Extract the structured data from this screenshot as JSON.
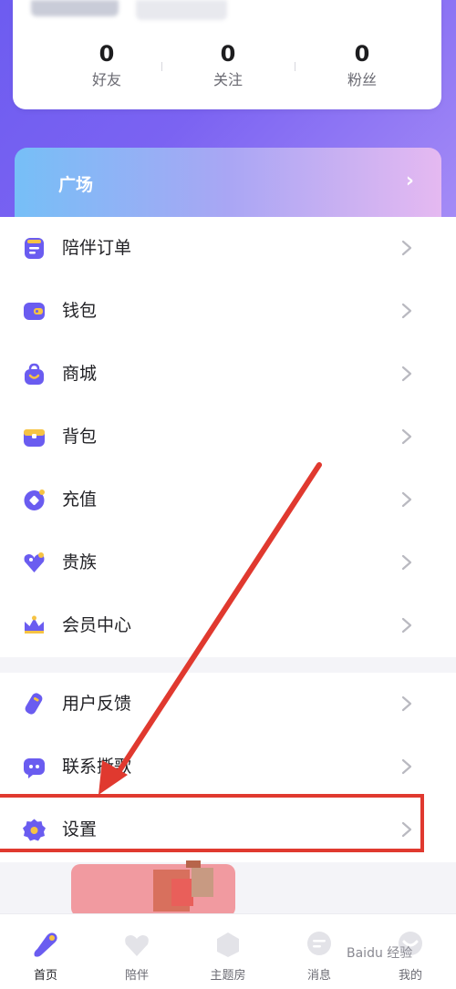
{
  "stats": [
    {
      "value": "0",
      "label": "好友"
    },
    {
      "value": "0",
      "label": "关注"
    },
    {
      "value": "0",
      "label": "粉丝"
    }
  ],
  "plaza": {
    "label": "广场",
    "arrow": "›"
  },
  "menu_group_1": [
    {
      "label": "陪伴订单",
      "icon": "order-list-icon"
    },
    {
      "label": "钱包",
      "icon": "wallet-icon"
    },
    {
      "label": "商城",
      "icon": "shopping-bag-icon"
    },
    {
      "label": "背包",
      "icon": "backpack-icon"
    },
    {
      "label": "充值",
      "icon": "coin-recharge-icon"
    },
    {
      "label": "贵族",
      "icon": "heart-diamond-icon"
    },
    {
      "label": "会员中心",
      "icon": "crown-icon"
    }
  ],
  "menu_group_2": [
    {
      "label": "用户反馈",
      "icon": "feedback-pen-icon"
    },
    {
      "label": "联系撕歌",
      "icon": "chat-bubble-icon"
    },
    {
      "label": "设置",
      "icon": "gear-icon"
    }
  ],
  "nav": [
    {
      "label": "首页",
      "icon": "home-icon",
      "active": true
    },
    {
      "label": "陪伴",
      "icon": "companion-icon",
      "active": false
    },
    {
      "label": "主题房",
      "icon": "theme-room-icon",
      "active": false
    },
    {
      "label": "消息",
      "icon": "message-icon",
      "active": false
    },
    {
      "label": "我的",
      "icon": "profile-icon",
      "active": false
    }
  ],
  "watermark": "Baidu 经验",
  "colors": {
    "accent": "#6a5cf0",
    "annotation": "#e0392f",
    "text": "#222226"
  }
}
